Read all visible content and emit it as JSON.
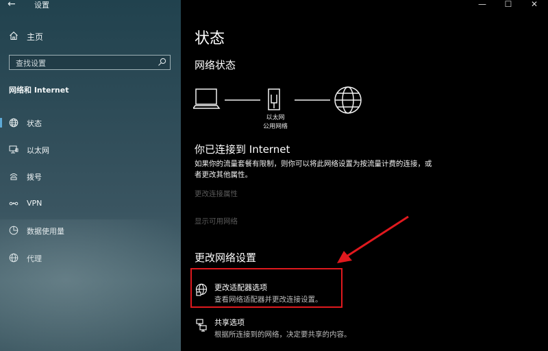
{
  "window": {
    "title": "设置",
    "controls": {
      "minimize": "—",
      "maximize": "☐",
      "close": "✕"
    },
    "back_glyph": "←"
  },
  "sidebar": {
    "home_label": "主页",
    "search_placeholder": "查找设置",
    "section_title": "网络和 Internet",
    "items": [
      {
        "label": "状态",
        "icon": "globe-icon",
        "active": true
      },
      {
        "label": "以太网",
        "icon": "ethernet-icon"
      },
      {
        "label": "拨号",
        "icon": "dialup-icon"
      },
      {
        "label": "VPN",
        "icon": "vpn-icon"
      },
      {
        "label": "数据使用量",
        "icon": "data-usage-icon"
      },
      {
        "label": "代理",
        "icon": "proxy-globe-icon"
      }
    ]
  },
  "main": {
    "page_title": "状态",
    "network_status_heading": "网络状态",
    "diagram": {
      "adapter_name": "以太网",
      "network_type": "公用网络"
    },
    "connected_heading": "你已连接到 Internet",
    "description": "如果你的流量套餐有限制，则你可以将此网络设置为按流量计费的连接，或者更改其他属性。",
    "link_change_properties": "更改连接属性",
    "link_show_networks": "显示可用网络",
    "change_settings_heading": "更改网络设置",
    "options": [
      {
        "title": "更改适配器选项",
        "subtitle": "查看网络适配器并更改连接设置。",
        "icon": "adapter-globe-icon"
      },
      {
        "title": "共享选项",
        "subtitle": "根据所连接到的网络，决定要共享的内容。",
        "icon": "sharing-icon"
      }
    ]
  },
  "annotation_color": "#e0191e",
  "accent_color": "#5ea9d6"
}
